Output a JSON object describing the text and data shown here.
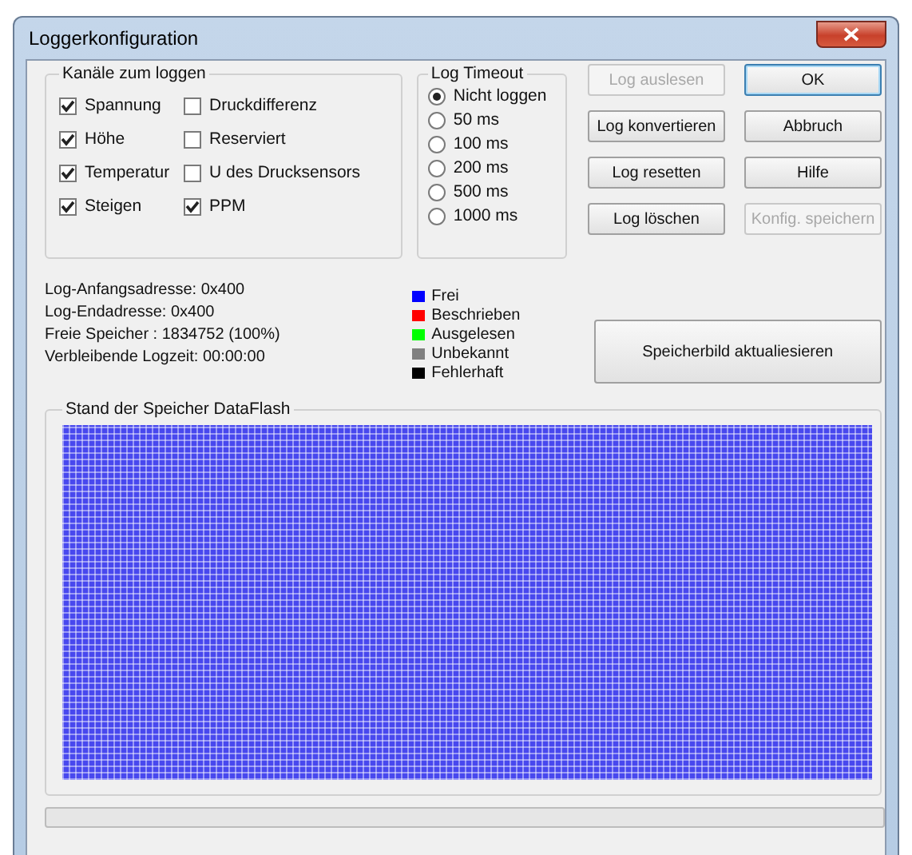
{
  "window": {
    "title": "Loggerkonfiguration"
  },
  "channels_group": {
    "title": "Kanäle zum loggen",
    "items": [
      {
        "label": "Spannung",
        "checked": true
      },
      {
        "label": "Druckdifferenz",
        "checked": false
      },
      {
        "label": "Höhe",
        "checked": true
      },
      {
        "label": "Reserviert",
        "checked": false
      },
      {
        "label": "Temperatur",
        "checked": true
      },
      {
        "label": "U des Drucksensors",
        "checked": false
      },
      {
        "label": "Steigen",
        "checked": true
      },
      {
        "label": "PPM",
        "checked": true
      }
    ]
  },
  "timeout_group": {
    "title": "Log Timeout",
    "options": [
      {
        "label": "Nicht loggen",
        "selected": true
      },
      {
        "label": "50 ms",
        "selected": false
      },
      {
        "label": "100 ms",
        "selected": false
      },
      {
        "label": "200 ms",
        "selected": false
      },
      {
        "label": "500 ms",
        "selected": false
      },
      {
        "label": "1000 ms",
        "selected": false
      }
    ]
  },
  "buttons": [
    {
      "label": "Log auslesen",
      "disabled": true,
      "default": false
    },
    {
      "label": "OK",
      "disabled": false,
      "default": true
    },
    {
      "label": "Log konvertieren",
      "disabled": false,
      "default": false
    },
    {
      "label": "Abbruch",
      "disabled": false,
      "default": false
    },
    {
      "label": "Log resetten",
      "disabled": false,
      "default": false
    },
    {
      "label": "Hilfe",
      "disabled": false,
      "default": false
    },
    {
      "label": "Log löschen",
      "disabled": false,
      "default": false
    },
    {
      "label": "Konfig. speichern",
      "disabled": true,
      "default": false
    }
  ],
  "info_lines": [
    "Log-Anfangsadresse: 0x400",
    "Log-Endadresse: 0x400",
    "Freie Speicher : 1834752 (100%)",
    "Verbleibende Logzeit: 00:00:00"
  ],
  "legend": [
    {
      "label": "Frei",
      "color": "#0000ff"
    },
    {
      "label": "Beschrieben",
      "color": "#ff0000"
    },
    {
      "label": "Ausgelesen",
      "color": "#00ff00"
    },
    {
      "label": "Unbekannt",
      "color": "#808080"
    },
    {
      "label": "Fehlerhaft",
      "color": "#000000"
    }
  ],
  "refresh_button": {
    "label": "Speicherbild aktualiesieren"
  },
  "memory_group": {
    "title": "Stand der Speicher DataFlash"
  }
}
